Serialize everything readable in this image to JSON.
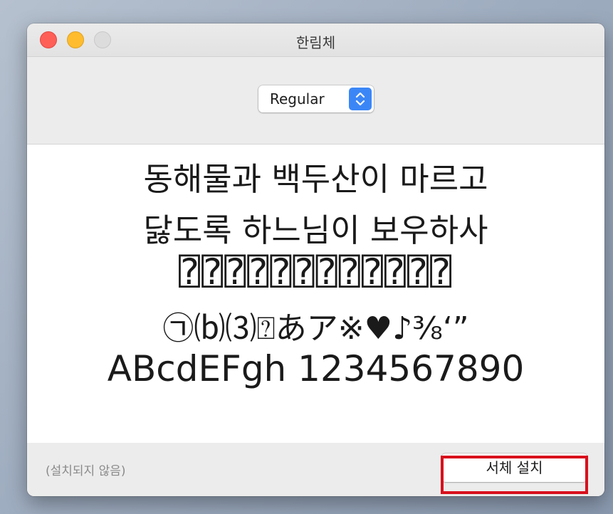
{
  "window": {
    "title": "한림체",
    "controls": {
      "close": "close-icon",
      "minimize": "minimize-icon",
      "zoom": "zoom-icon"
    }
  },
  "style_select": {
    "selected": "Regular",
    "icon": "chevron-up-down-icon",
    "accent_color": "#3b86f7"
  },
  "preview": {
    "lines": [
      "동해물과 백두산이 마르고",
      "닳도록 하느님이 보우하사",
      "⍰⍰⍰⍰⍰⍰⍰⍰⍰⍰⍰⍰",
      "㉠⒝⑶⍰あア※♥♪⅜‘”",
      "ABcdEFgh 1234567890"
    ]
  },
  "footer": {
    "status": "(설치되지 않음)",
    "install_label": "서체 설치"
  },
  "highlight": {
    "color": "#d8101c"
  }
}
